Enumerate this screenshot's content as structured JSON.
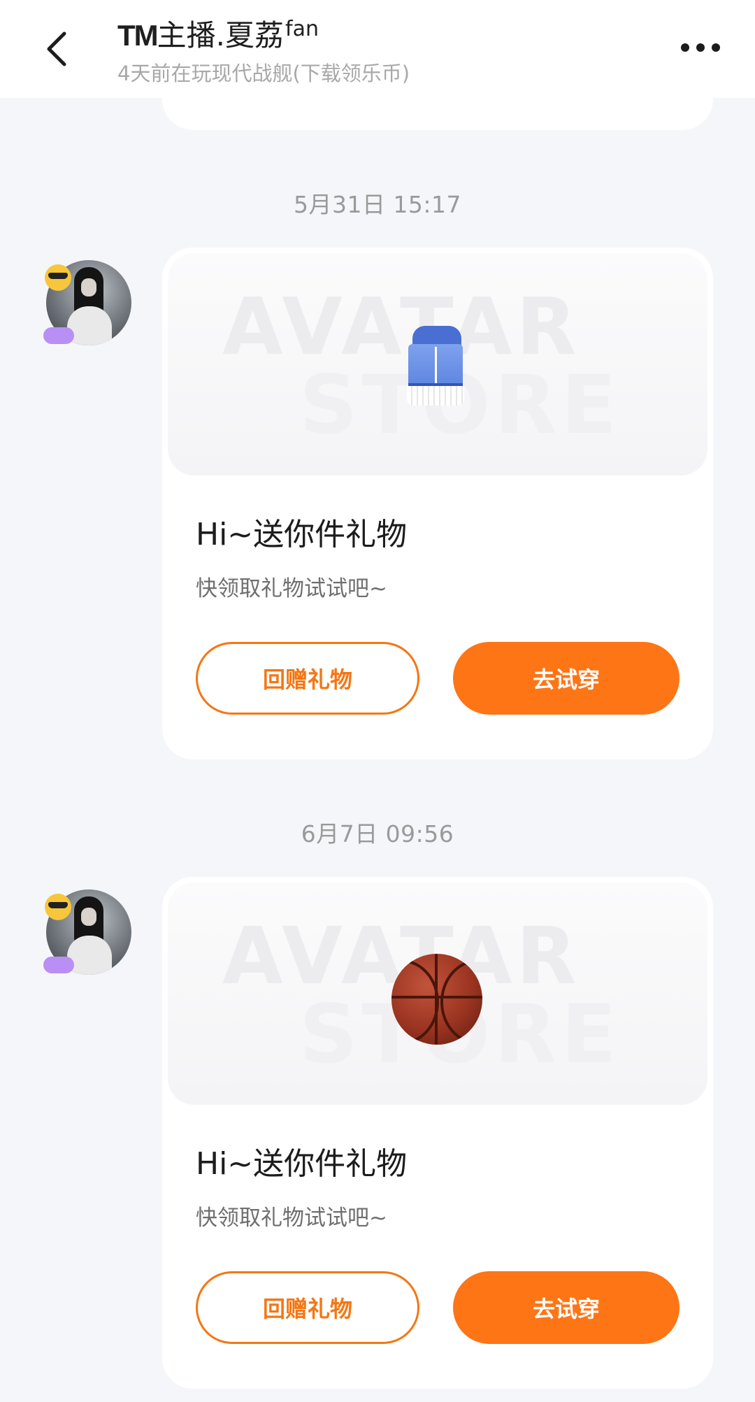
{
  "header": {
    "title_prefix": "TM",
    "title_main": "主播.夏荔",
    "title_sup": "fan",
    "subtitle": "4天前在玩现代战舰(下载领乐币)"
  },
  "messages": [
    {
      "timestamp": "5月31日 15:17",
      "item": "jacket-icon",
      "watermark_1": "AVATAR",
      "watermark_2": "STORE",
      "title": "Hi~送你件礼物",
      "desc": "快领取礼物试试吧~",
      "return_gift_label": "回赠礼物",
      "try_on_label": "去试穿"
    },
    {
      "timestamp": "6月7日 09:56",
      "item": "basketball-icon",
      "watermark_1": "AVATAR",
      "watermark_2": "STORE",
      "title": "Hi~送你件礼物",
      "desc": "快领取礼物试试吧~",
      "return_gift_label": "回赠礼物",
      "try_on_label": "去试穿"
    }
  ],
  "colors": {
    "accent": "#fe7516",
    "background": "#f5f6fa",
    "card": "#ffffff"
  }
}
